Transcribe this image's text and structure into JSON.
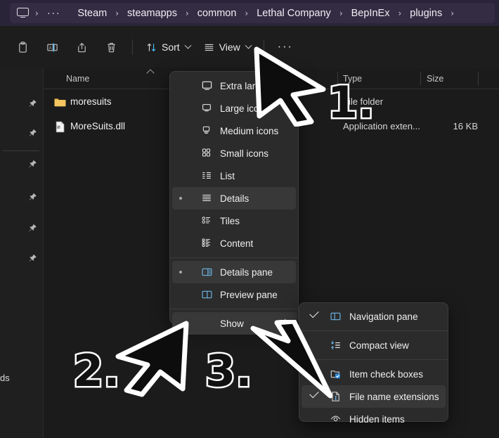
{
  "window": {
    "address_bar": {
      "device_icon": "monitor-icon",
      "overflow": "···",
      "crumbs": [
        "Steam",
        "steamapps",
        "common",
        "Lethal Company",
        "BepInEx",
        "plugins"
      ],
      "separator": "›"
    },
    "toolbar": {
      "icons": [
        {
          "name": "paste-icon",
          "label": ""
        },
        {
          "name": "rename-icon",
          "label": ""
        },
        {
          "name": "share-icon",
          "label": ""
        },
        {
          "name": "delete-icon",
          "label": ""
        }
      ],
      "sort_label": "Sort",
      "view_label": "View",
      "more_label": "···"
    }
  },
  "left_nav": {
    "pin_count": 6,
    "visible_label": "ds"
  },
  "file_list": {
    "columns": [
      {
        "key": "name",
        "label": "Name"
      },
      {
        "key": "type",
        "label": "Type"
      },
      {
        "key": "size",
        "label": "Size"
      }
    ],
    "rows": [
      {
        "icon": "folder-icon",
        "name": "moresuits",
        "type": "File folder",
        "size": ""
      },
      {
        "icon": "dll-file-icon",
        "name": "MoreSuits.dll",
        "type": "Application exten...",
        "size": "16 KB"
      }
    ]
  },
  "view_menu": {
    "items": [
      {
        "label": "Extra large i",
        "icon": "extra-large-icons-icon",
        "selected": false,
        "truncated": true
      },
      {
        "label": "Large icons",
        "icon": "large-icons-icon",
        "selected": false
      },
      {
        "label": "Medium icons",
        "icon": "medium-icons-icon",
        "selected": false
      },
      {
        "label": "Small icons",
        "icon": "small-icons-icon",
        "selected": false
      },
      {
        "label": "List",
        "icon": "list-view-icon",
        "selected": false
      },
      {
        "label": "Details",
        "icon": "details-view-icon",
        "selected": true
      },
      {
        "label": "Tiles",
        "icon": "tiles-view-icon",
        "selected": false
      },
      {
        "label": "Content",
        "icon": "content-view-icon",
        "selected": false
      },
      {
        "label": "Details pane",
        "icon": "details-pane-icon",
        "selected": true
      },
      {
        "label": "Preview pane",
        "icon": "preview-pane-icon",
        "selected": false
      },
      {
        "label": "Show",
        "icon": "",
        "selected": false,
        "submenu": true
      }
    ]
  },
  "show_submenu": {
    "items": [
      {
        "label": "Navigation pane",
        "icon": "navigation-pane-icon",
        "checked": true,
        "highlighted": false
      },
      {
        "label": "Compact view",
        "icon": "compact-view-icon",
        "checked": false,
        "highlighted": false
      },
      {
        "label": "Item check boxes",
        "icon": "item-check-boxes-icon",
        "checked": false,
        "highlighted": false
      },
      {
        "label": "File name extensions",
        "icon": "file-name-extensions-icon",
        "checked": true,
        "highlighted": true
      },
      {
        "label": "Hidden items",
        "icon": "hidden-items-icon",
        "checked": false,
        "highlighted": false
      }
    ]
  },
  "annotations": [
    {
      "number": "1.",
      "target": "view-button"
    },
    {
      "number": "2.",
      "target": "show-menu-item"
    },
    {
      "number": "3.",
      "target": "file-name-extensions-item"
    }
  ],
  "colors": {
    "address_bar_bg": "#2a2438",
    "address_pill_bg": "#332c42",
    "menu_bg": "#2b2b2b",
    "menu_highlight": "#383838",
    "accent_icon": "#4cc2ff",
    "folder": "#e8b44a"
  }
}
